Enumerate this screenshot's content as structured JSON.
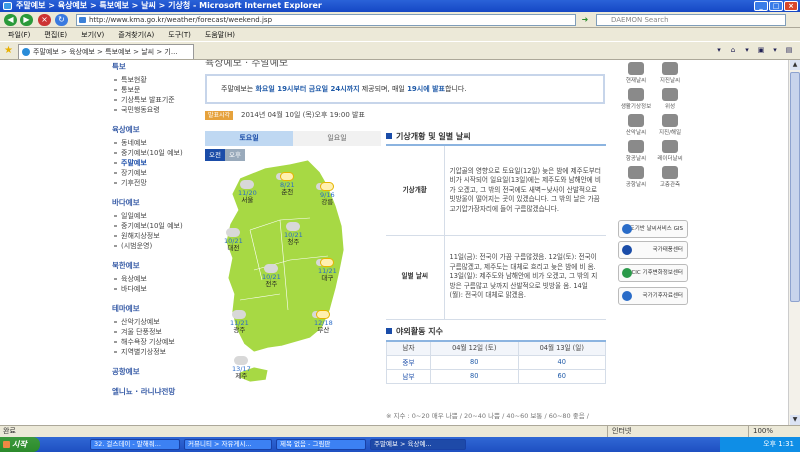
{
  "window": {
    "title": "주말예보 > 육상예보 > 특보예보 > 날씨 > 기상청 - Microsoft Internet Explorer",
    "min": "_",
    "max": "□",
    "close": "×"
  },
  "address": {
    "url": "http://www.kma.go.kr/weather/forecast/weekend.jsp",
    "search_placeholder": "DAEMON Search"
  },
  "menu": [
    "파일(F)",
    "편집(E)",
    "보기(V)",
    "즐겨찾기(A)",
    "도구(T)",
    "도움말(H)"
  ],
  "tab": {
    "label": "주말예보 > 육상예보 > 특보예보 > 날씨 > 기..."
  },
  "toolbar_right": [
    "▾",
    "⌂",
    "▾",
    "▣",
    "▾",
    "▤"
  ],
  "page_title": "육상예보 · 주말예보",
  "left_nav": [
    {
      "head": "특보",
      "items": [
        "특보현황",
        "통보문",
        "기상특보 발표기준",
        "국민행동요령"
      ]
    },
    {
      "head": "육상예보",
      "items": [
        "동네예보",
        "중기예보(10일 예보)",
        "주말예보",
        "장기예보",
        "기후전망"
      ],
      "selected": 2
    },
    {
      "head": "바다예보",
      "items": [
        "일일예보",
        "중기예보(10일 예보)",
        "원해지상정보",
        "(시범운영)"
      ]
    },
    {
      "head": "북한예보",
      "items": [
        "육상예보",
        "바다예보"
      ]
    },
    {
      "head": "테마예보",
      "items": [
        "산악기상예보",
        "겨울 단풍정보",
        "해수욕장 기상예보",
        "지역별기상정보"
      ]
    },
    {
      "head": "공항예보",
      "items": []
    },
    {
      "head": "엘니뇨 · 라니냐전망",
      "items": []
    }
  ],
  "banner": {
    "pre": "주말예보는 ",
    "b1": "화요일 19시부터 금요일 24시까지",
    "mid": " 제공되며, 매일 ",
    "b2": "19시에 발표",
    "post": "합니다."
  },
  "issued": {
    "badge": "발표시각",
    "text": "2014년 04월 10일 (목)오후 19:00 발표"
  },
  "day_tabs": {
    "sat": "토요일",
    "sun": "일요일"
  },
  "ampm": {
    "am": "오전",
    "pm": "오후"
  },
  "map_cities": [
    {
      "city": "서울",
      "temp": "11/20",
      "icon": "cloudy"
    },
    {
      "city": "춘천",
      "temp": "8/21",
      "icon": "sunny"
    },
    {
      "city": "강릉",
      "temp": "9/16",
      "icon": "sunny"
    },
    {
      "city": "대전",
      "temp": "10/21",
      "icon": "cloudy"
    },
    {
      "city": "청주",
      "temp": "10/21",
      "icon": "cloudy"
    },
    {
      "city": "대구",
      "temp": "11/21",
      "icon": "sunny"
    },
    {
      "city": "전주",
      "temp": "10/21",
      "icon": "cloudy"
    },
    {
      "city": "광주",
      "temp": "11/21",
      "icon": "cloudy"
    },
    {
      "city": "부산",
      "temp": "12/18",
      "icon": "sunny"
    },
    {
      "city": "제주",
      "temp": "13/17",
      "icon": "cloudy"
    }
  ],
  "right_title": "기상개황 및 일별 날씨",
  "rows": [
    {
      "label": "기상개황",
      "text": "기압골의 영향으로 토요일(12일) 늦은 밤에 제주도부터 비가 시작되어 일요일(13일)에는 제주도와 남해안에 비가 오겠고, 그 밖의 전국에도 새벽~낮사이 산발적으로 빗방울이 떨어지는 곳이 있겠습니다. 그 밖의 날은 가끔 고기압가장자리에 들어 구름많겠습니다."
    },
    {
      "label": "일별 날씨",
      "text": "11일(금): 전국이 가끔 구름많겠음. 12일(토): 전국이 구름많겠고, 제주도는 대체로 흐리고 늦은 밤에 비 옴. 13일(일): 제주도와 남해안에 비가 오겠고, 그 밖의 지방은 구름많고 낮까지 산발적으로 빗방울 옴. 14일(월): 전국이 대체로 맑겠음."
    }
  ],
  "outdoor": {
    "title": "야외활동 지수",
    "headers": [
      "남자",
      "04월 12일 (토)",
      "04월 13일 (일)"
    ],
    "rows": [
      {
        "zone": "중부",
        "d1": "80",
        "d2": "40"
      },
      {
        "zone": "남부",
        "d1": "80",
        "d2": "60"
      }
    ],
    "note": "※ 지수 : 0~20 매우 나쁨 / 20~40 나쁨 / 40~60 보통 / 60~80 좋음 /"
  },
  "right_icons": [
    "현재날씨",
    "지진날씨",
    "생활기상정보",
    "위성",
    "산악날씨",
    "지진/해일",
    "항공날씨",
    "레이더날씨",
    "공항날씨",
    "고층관측"
  ],
  "promos": [
    {
      "label": "지도기반 날씨서비스 GIS Service",
      "color": "#2a6cc8"
    },
    {
      "label": "국가태풍센터",
      "color": "#1a4ca8"
    },
    {
      "label": "CCIC 기후변화정보센터",
      "color": "#2a9a4a"
    },
    {
      "label": "국가기후자료센터",
      "color": "#2a6cc8"
    }
  ],
  "status": {
    "left": "완료",
    "zone": "인터넷",
    "zoom": "100%"
  },
  "taskbar": {
    "start": "시작",
    "tasks": [
      "32. 걸스데이 - 말해줘...",
      "커뮤니티 > 자유게시...",
      "제목 없음 - 그림판",
      "주말예보 > 육상예..."
    ],
    "clock": "오후 1:31"
  }
}
